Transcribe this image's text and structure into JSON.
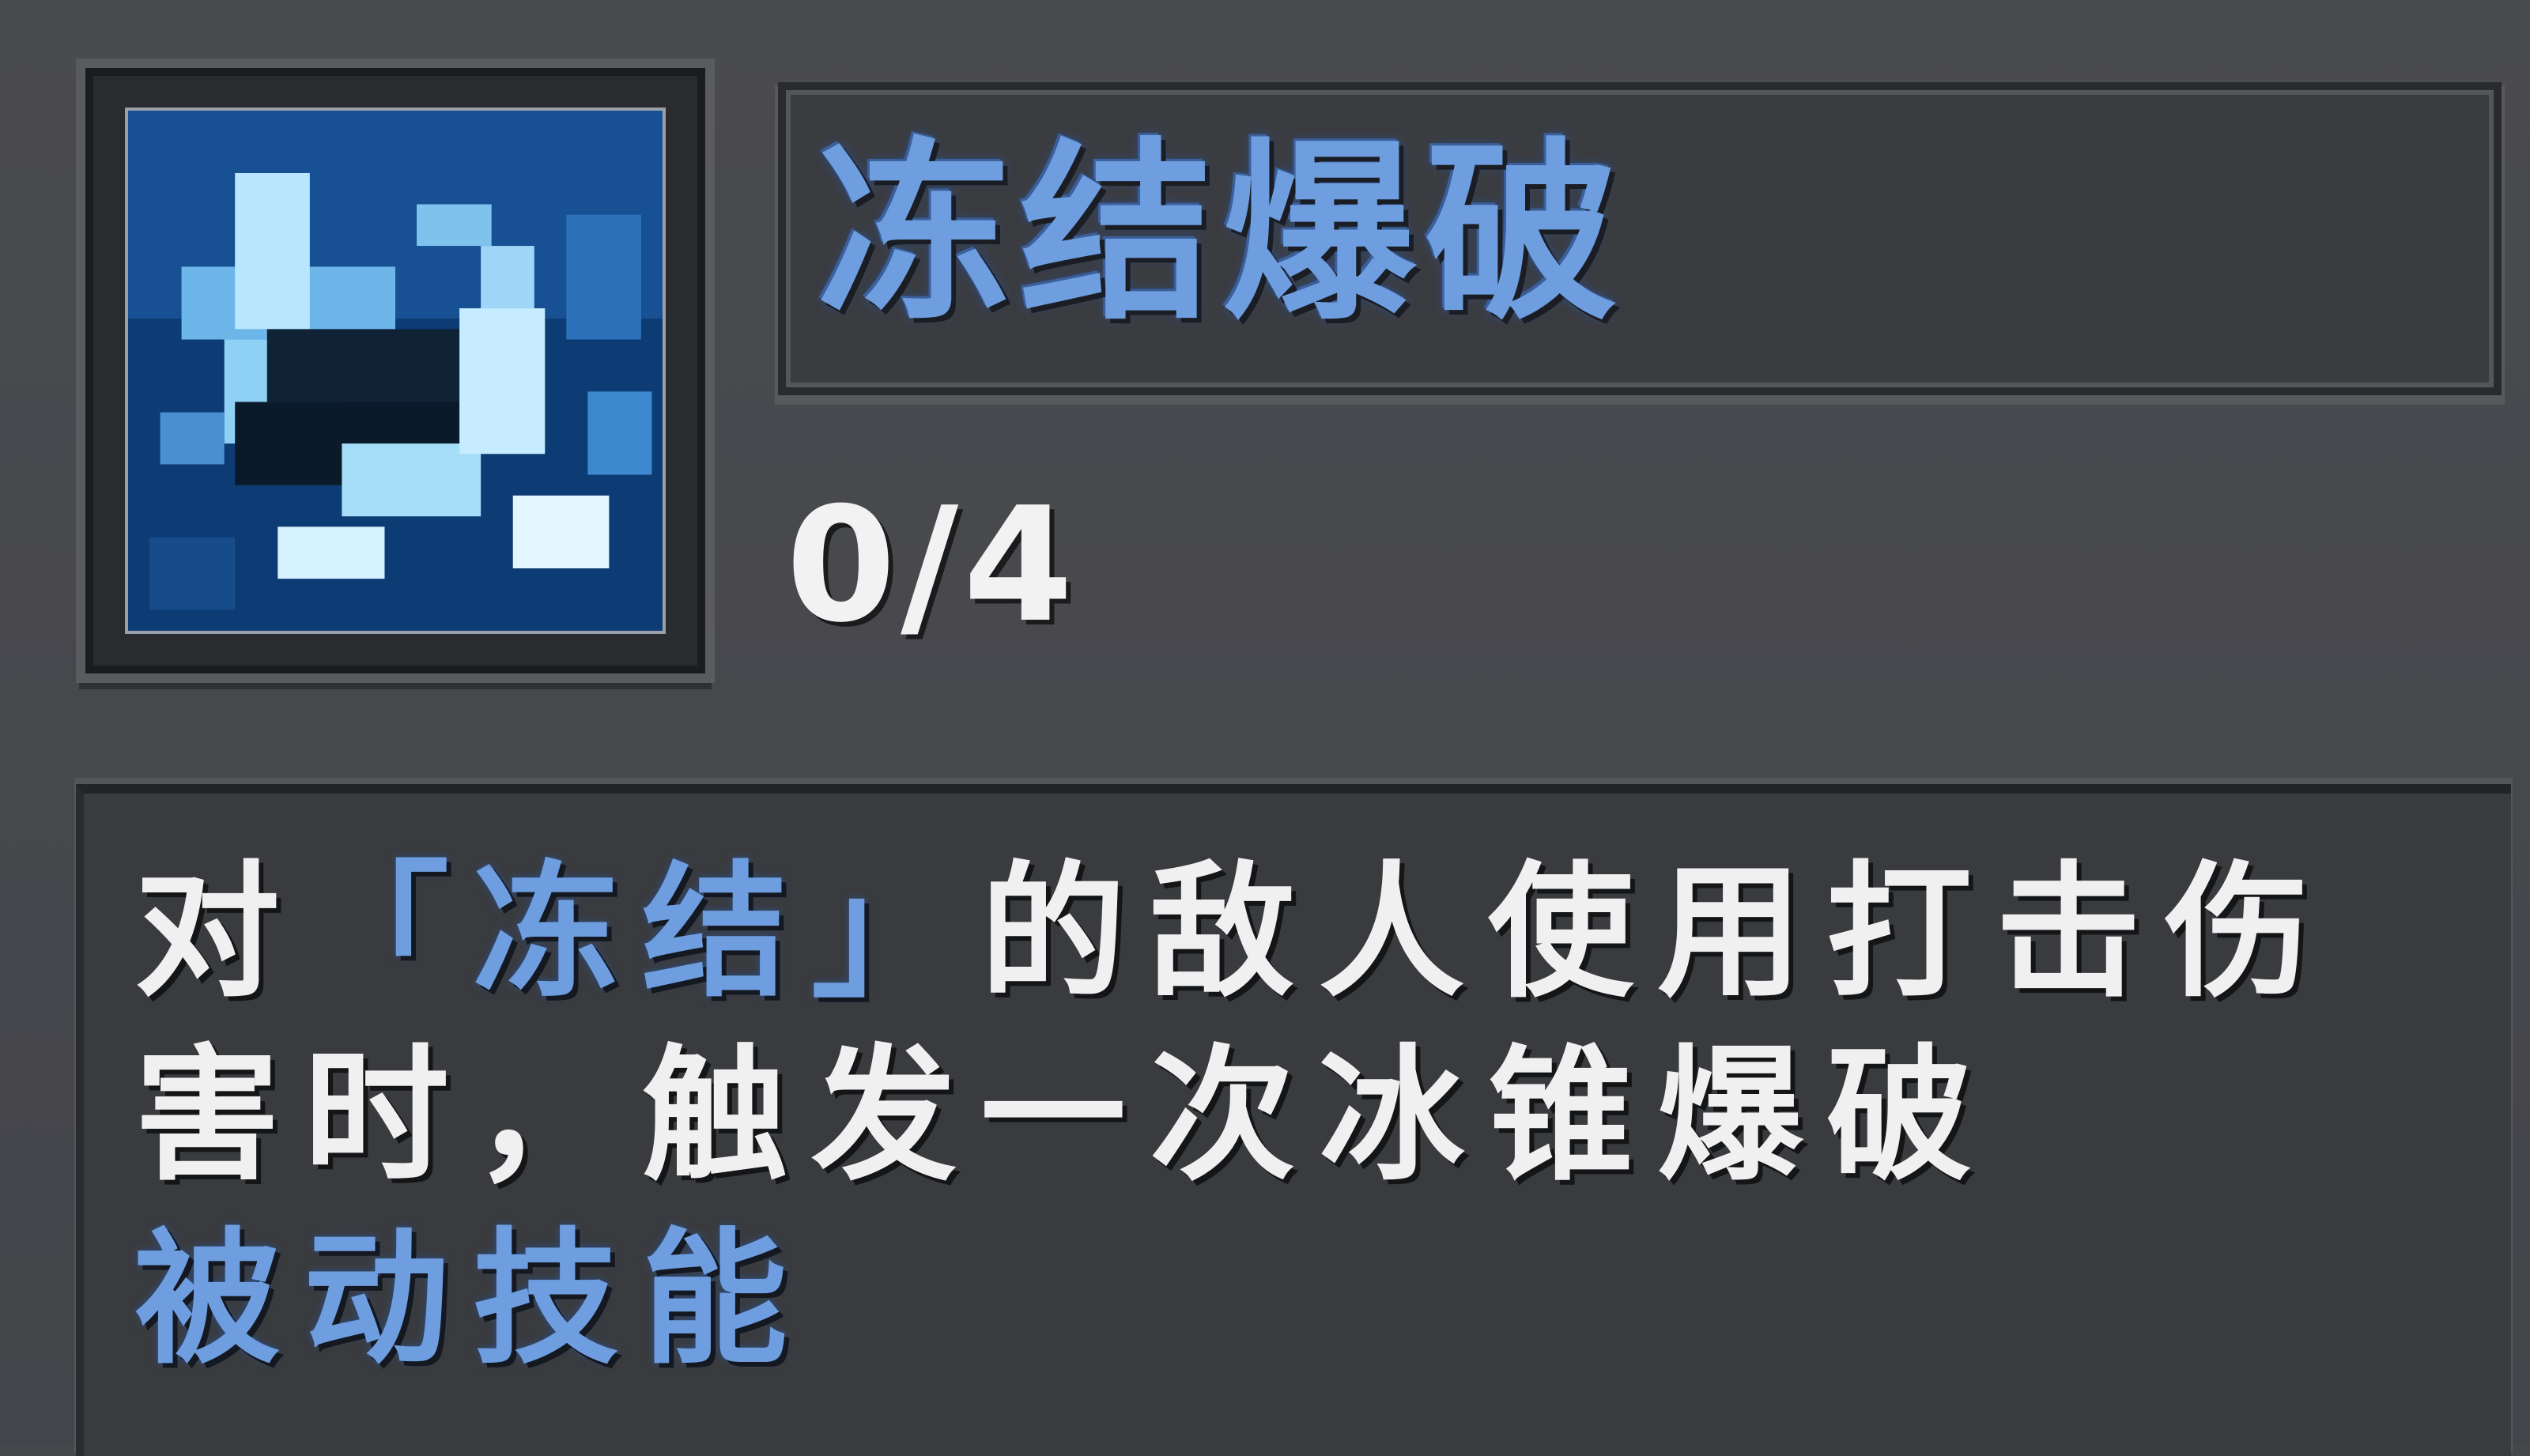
{
  "card": {
    "skill_name": "冻结爆破",
    "count": "0/4",
    "icon": "ice-shatter-skill-icon",
    "description": {
      "line1_prefix": "对",
      "line1_keyword": "「冻结」",
      "line1_suffix": "的敌人使用打击伤",
      "line2": "害时，触发一次冰锥爆破",
      "skill_type": "被动技能"
    }
  },
  "colors": {
    "background": "#46474a",
    "accent_blue": "#6f9ee0",
    "text_white": "#f0f0f0"
  }
}
